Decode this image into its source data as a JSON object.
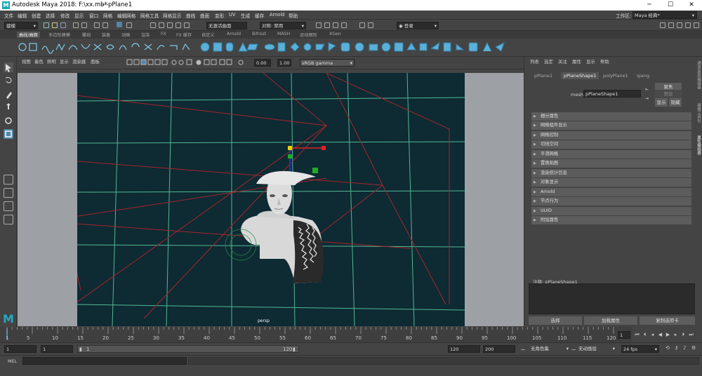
{
  "window": {
    "app_title": "Autodesk Maya 2018: F:\\xx.mb*",
    "separator": "---",
    "object_title": "pPlane1",
    "minimize": "─",
    "maximize": "☐",
    "close": "✕"
  },
  "menubar": {
    "items": [
      "文件",
      "编辑",
      "创建",
      "选择",
      "修改",
      "显示",
      "窗口",
      "网格",
      "编辑网格",
      "网格工具",
      "网格显示",
      "曲线",
      "曲面",
      "变形",
      "UV",
      "生成",
      "缓存",
      "Arnold",
      "帮助"
    ],
    "workspace_label": "工作区:",
    "workspace_value": "Maya 经典*"
  },
  "statusline": {
    "mode": "建模",
    "live_surface": "无激活曲面",
    "symmetry": "对称: 禁用",
    "login": "登录"
  },
  "shelf": {
    "tabs": [
      "曲线/曲面",
      "多边形建模",
      "雕刻",
      "装备",
      "动画",
      "渲染",
      "FX",
      "FX 缓存",
      "自定义",
      "Arnold",
      "Bifrost",
      "MASH",
      "运动图形",
      "XGen"
    ],
    "active_tab": 0
  },
  "viewport": {
    "menus": [
      "视图",
      "着色",
      "照明",
      "显示",
      "渲染器",
      "面板"
    ],
    "field1": "0.00",
    "field2": "1.00",
    "color_space": "sRGB gamma",
    "camera_label": "persp"
  },
  "attribute_editor": {
    "menus": [
      "列表",
      "选定",
      "关注",
      "属性",
      "显示",
      "帮助"
    ],
    "tabs": [
      "pPlane1",
      "pPlaneShape1",
      "polyPlane1",
      "qiang"
    ],
    "active_tab": 1,
    "mesh_label": "mesh:",
    "mesh_value": "pPlaneShape1",
    "focus_btn": "聚焦",
    "preset_btn": "预设",
    "show_btn": "显示",
    "hide_btn": "隐藏",
    "sections": [
      "细分属性",
      "网格组件显示",
      "网格控制",
      "切线空间",
      "平滑网格",
      "置换贴图",
      "渲染统计信息",
      "对象显示",
      "Arnold",
      "节点行为",
      "UUID",
      "附加属性"
    ],
    "notes_label": "注释: pPlaneShape1",
    "bottom_buttons": [
      "选择",
      "加载属性",
      "复制选项卡"
    ]
  },
  "side_tabs": [
    "通道盒/层编辑器",
    "建模工具包",
    "属性编辑器"
  ],
  "timeline": {
    "ticks": [
      "1",
      "5",
      "10",
      "15",
      "20",
      "25",
      "30",
      "35",
      "40",
      "45",
      "50",
      "55",
      "60",
      "65",
      "70",
      "75",
      "80",
      "85",
      "90",
      "95",
      "100",
      "105",
      "110",
      "115",
      "120"
    ],
    "current_frame": "1"
  },
  "range": {
    "start": "1",
    "start_inner": "1",
    "slider_start": "1",
    "slider_end": "120",
    "end_inner": "120",
    "end": "200",
    "char_set": "无角色集",
    "anim_layer": "无动画层",
    "fps": "24 fps"
  },
  "mel": {
    "label": "MEL"
  },
  "colors": {
    "accent": "#5285a6",
    "viewport_bg": "#0e2a33",
    "grid": "#58c9a0",
    "camera_lines": "#a3262b",
    "gate": "#9da1a5"
  }
}
